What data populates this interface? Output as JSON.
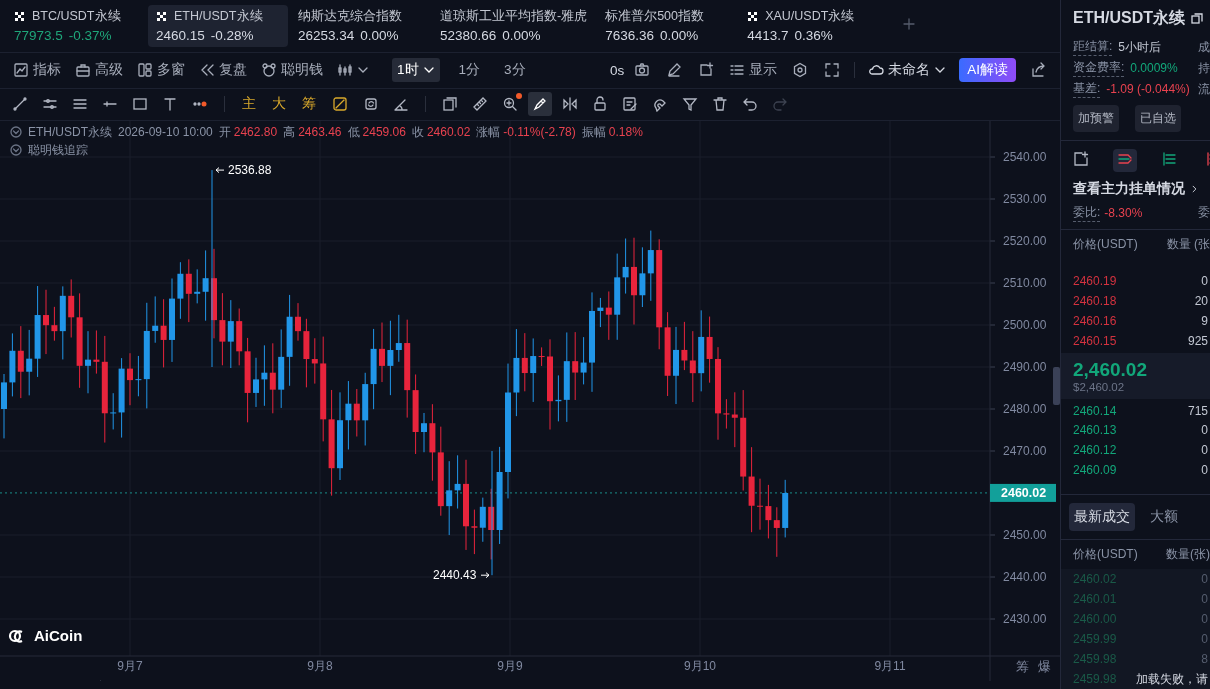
{
  "tickers": [
    {
      "symbol": "BTC/USDT永续",
      "price": "77973.5",
      "change": "-0.37%",
      "logo": true,
      "color": "#1fa67a",
      "selected": false
    },
    {
      "symbol": "ETH/USDT永续",
      "price": "2460.15",
      "change": "-0.28%",
      "logo": true,
      "color": "#d5d9e2",
      "selected": true
    },
    {
      "symbol": "纳斯达克综合指数",
      "price": "26253.34",
      "change": "0.00%",
      "logo": false,
      "color": "#d5d9e2",
      "selected": false
    },
    {
      "symbol": "道琼斯工业平均指数-雅虎",
      "price": "52380.66",
      "change": "0.00%",
      "logo": false,
      "color": "#d5d9e2",
      "selected": false
    },
    {
      "symbol": "标准普尔500指数",
      "price": "7636.36",
      "change": "0.00%",
      "logo": false,
      "color": "#d5d9e2",
      "selected": false
    },
    {
      "symbol": "XAU/USDT永续",
      "price": "4413.7",
      "change": "0.36%",
      "logo": true,
      "color": "#d5d9e2",
      "selected": false
    }
  ],
  "toolbar": {
    "tools": [
      "指标",
      "高级",
      "多窗",
      "复盘",
      "聪明钱"
    ],
    "intervals": [
      {
        "label": "1时",
        "selected": true,
        "dropdown": true
      },
      {
        "label": "1分",
        "selected": false,
        "dropdown": false
      },
      {
        "label": "3分",
        "selected": false,
        "dropdown": false
      }
    ],
    "countdown": "0s",
    "display": "显示",
    "layout": "未命名",
    "ai_button": "AI解读"
  },
  "drawing": {
    "indicators": [
      "主",
      "大",
      "筹"
    ],
    "tools": [
      {
        "selected": false,
        "disabled": false
      },
      {
        "selected": false,
        "disabled": false
      },
      {
        "selected": false,
        "disabled": false
      },
      {
        "selected": true,
        "disabled": false
      },
      {
        "selected": false,
        "disabled": false
      },
      {
        "selected": false,
        "disabled": false
      },
      {
        "selected": false,
        "disabled": false
      },
      {
        "selected": false,
        "disabled": false
      },
      {
        "selected": false,
        "disabled": false
      },
      {
        "selected": false,
        "disabled": false
      },
      {
        "selected": false,
        "disabled": false
      },
      {
        "selected": false,
        "disabled": true
      }
    ]
  },
  "chart": {
    "symbol": "ETH/USDT永续",
    "time": "2026-09-10 10:00",
    "stats": [
      {
        "label": "开",
        "value": "2462.80"
      },
      {
        "label": "高",
        "value": "2463.46"
      },
      {
        "label": "低",
        "value": "2459.06"
      },
      {
        "label": "收",
        "value": "2460.02"
      },
      {
        "label": "涨幅",
        "value": "-0.11%(-2.78)"
      },
      {
        "label": "振幅",
        "value": "0.18%"
      }
    ],
    "overlay": "聪明钱追踪",
    "y_ticks": [
      "2540.00",
      "2530.00",
      "2520.00",
      "2510.00",
      "2500.00",
      "2490.00",
      "2480.00",
      "2470.00",
      "2450.00",
      "2440.00",
      "2430.00"
    ],
    "x_labels": [
      "9月7",
      "9月8",
      "9月9",
      "9月10",
      "9月11"
    ],
    "high_marker": "2536.88",
    "low_marker": "2440.43",
    "last_price": "2460.02",
    "watermark": "AiCoin",
    "side_labels": [
      "筹",
      "爆"
    ]
  },
  "panel": {
    "title": "ETH/USDT永续",
    "info": [
      {
        "label": "距结算:",
        "value": "5小时后",
        "color": "#c3c8d3",
        "more": "成"
      },
      {
        "label": "资金费率:",
        "value": "0.0009%",
        "color": "#12a77a",
        "more": "持"
      },
      {
        "label": "基差:",
        "value": "-1.09 (-0.044%)",
        "color": "#e8424f",
        "more": "流"
      }
    ],
    "buttons": [
      "加预警",
      "已自选"
    ],
    "view_tabs": [
      {
        "selected": false
      },
      {
        "selected": true
      },
      {
        "selected": false
      },
      {
        "selected": false
      }
    ],
    "link": "查看主力挂单情况",
    "ratio": {
      "label": "委比:",
      "value": "-8.30%",
      "more": "委"
    },
    "book_header": [
      "价格(USDT)",
      "数量 (张"
    ],
    "asks": [
      {
        "price": "2460.19",
        "qty": "0"
      },
      {
        "price": "2460.18",
        "qty": "20"
      },
      {
        "price": "2460.16",
        "qty": "9"
      },
      {
        "price": "2460.15",
        "qty": "925"
      }
    ],
    "mid": {
      "price": "2,460.02",
      "usd": "$2,460.02"
    },
    "bids": [
      {
        "price": "2460.14",
        "qty": "715"
      },
      {
        "price": "2460.13",
        "qty": "0"
      },
      {
        "price": "2460.12",
        "qty": "0"
      },
      {
        "price": "2460.09",
        "qty": "0"
      }
    ],
    "trade_tabs": [
      {
        "label": "最新成交",
        "selected": true
      },
      {
        "label": "大额",
        "selected": false
      }
    ],
    "trade_header": [
      "价格(USDT)",
      "数量(张)"
    ],
    "trades": [
      {
        "price": "2460.02",
        "qty": "0"
      },
      {
        "price": "2460.01",
        "qty": "0"
      },
      {
        "price": "2460.00",
        "qty": "0"
      },
      {
        "price": "2459.99",
        "qty": "0"
      },
      {
        "price": "2459.98",
        "qty": "8"
      },
      {
        "price": "2459.98",
        "notice": "加载失败，请"
      }
    ]
  }
}
